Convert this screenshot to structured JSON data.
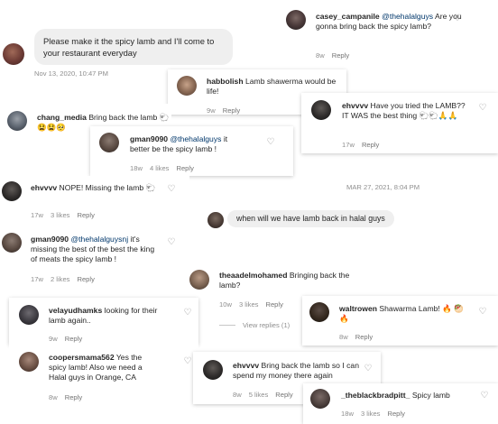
{
  "dm": {
    "bubble_text": "Please make it the spicy lamb and I'll come to your restaurant everyday",
    "timestamp": "Nov 13, 2020, 10:47 PM",
    "timestamp2": "MAR 27, 2021, 8:04 PM",
    "bubble2_text": "when will we have lamb back in halal guys"
  },
  "comments": [
    {
      "user": "casey_campanile",
      "mention": "@thehalalguys",
      "text": "Are you gonna bring back the spicy lamb?",
      "age": "8w",
      "likes": "",
      "reply": "Reply"
    },
    {
      "user": "habbolish",
      "mention": "",
      "text": "Lamb shawerma would be life!",
      "age": "9w",
      "likes": "",
      "reply": "Reply"
    },
    {
      "user": "ehvvvv",
      "mention": "",
      "text": "Have you tried the LAMB?? IT WAS the best thing 🐑🐑🙏🙏",
      "age": "17w",
      "likes": "",
      "reply": "Reply"
    },
    {
      "user": "chang_media",
      "mention": "",
      "text": "Bring back the lamb 🐑😫😫🥺",
      "age": "",
      "likes": "",
      "reply": ""
    },
    {
      "user": "gman9090",
      "mention": "@thehalalguys",
      "text": "it better be the spicy lamb !",
      "age": "18w",
      "likes": "4 likes",
      "reply": "Reply"
    },
    {
      "user": "ehvvvv",
      "mention": "",
      "text": "NOPE! Missing the lamb 🐑",
      "age": "17w",
      "likes": "3 likes",
      "reply": "Reply"
    },
    {
      "user": "gman9090",
      "mention": "@thehalalguysnj",
      "text": "it's missing the best of the best the king of meats the spicy lamb !",
      "age": "17w",
      "likes": "2 likes",
      "reply": "Reply"
    },
    {
      "user": "theaadelmohamed",
      "mention": "",
      "text": "Bringing back the lamb?",
      "age": "10w",
      "likes": "3 likes",
      "reply": "Reply",
      "view_replies": "View replies (1)"
    },
    {
      "user": "velayudhamks",
      "mention": "",
      "text": "looking for their lamb again..",
      "age": "9w",
      "likes": "",
      "reply": "Reply"
    },
    {
      "user": "waltrowen",
      "mention": "",
      "text": "Shawarma Lamb! 🔥 🥙🔥",
      "age": "8w",
      "likes": "",
      "reply": "Reply"
    },
    {
      "user": "coopersmama562",
      "mention": "",
      "text": "Yes the spicy lamb! Also we need a Halal guys in Orange, CA",
      "age": "8w",
      "likes": "",
      "reply": "Reply"
    },
    {
      "user": "ehvvvv",
      "mention": "",
      "text": "Bring back the lamb so I can spend my money there again",
      "age": "8w",
      "likes": "5 likes",
      "reply": "Reply"
    },
    {
      "user": "_theblackbradpitt_",
      "mention": "",
      "text": "Spicy lamb",
      "age": "18w",
      "likes": "3 likes",
      "reply": "Reply"
    }
  ],
  "icons": {
    "heart": "heart-outline-icon"
  }
}
